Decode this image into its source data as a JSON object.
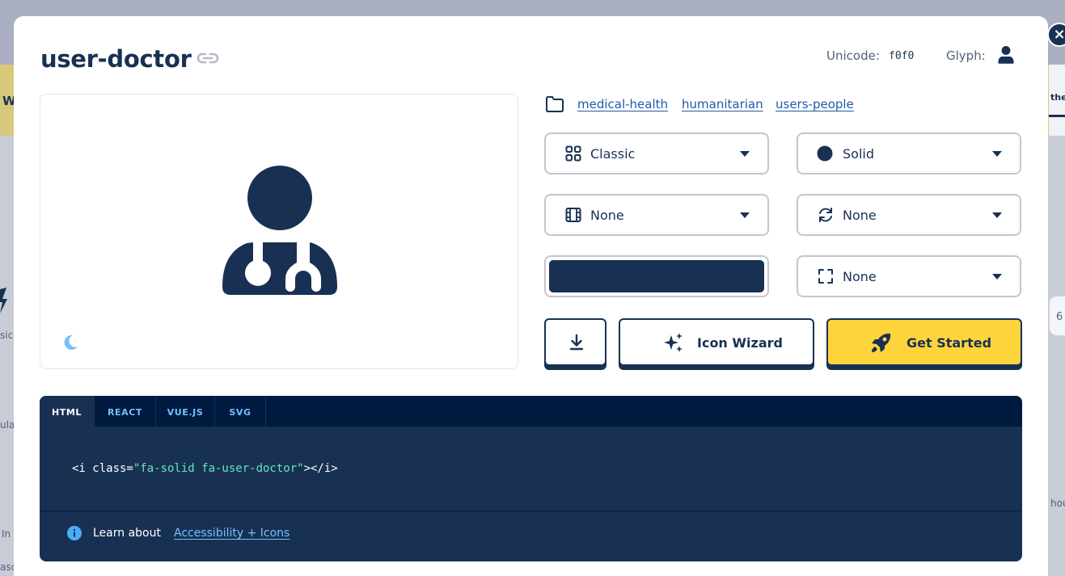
{
  "background": {
    "fragments": [
      "W",
      "sic",
      "ular",
      "In",
      "asc",
      "the",
      "hou",
      "6"
    ]
  },
  "modal": {
    "close_label": "×",
    "title": "user-doctor",
    "unicode_label": "Unicode:",
    "unicode_value": "f0f0",
    "glyph_label": "Glyph:",
    "categories": [
      "medical-health",
      "humanitarian",
      "users-people"
    ],
    "selects": {
      "family": "Classic",
      "style": "Solid",
      "animation": "None",
      "rotation": "None",
      "size": "None"
    },
    "color": "#183153",
    "buttons": {
      "wizard": "Icon Wizard",
      "get_started": "Get Started"
    },
    "code": {
      "tabs": [
        "HTML",
        "REACT",
        "VUE.JS",
        "SVG"
      ],
      "active_tab": "HTML",
      "open": "<i class=",
      "class_value": "\"fa-solid fa-user-doctor\"",
      "close": "></i>"
    },
    "footer": {
      "learn_label": "Learn about",
      "learn_link": "Accessibility + Icons"
    }
  },
  "colors": {
    "navy": "#183153",
    "accent_yellow": "#ffd43b",
    "link_blue": "#1f5aa6",
    "code_string": "#63e6be"
  }
}
